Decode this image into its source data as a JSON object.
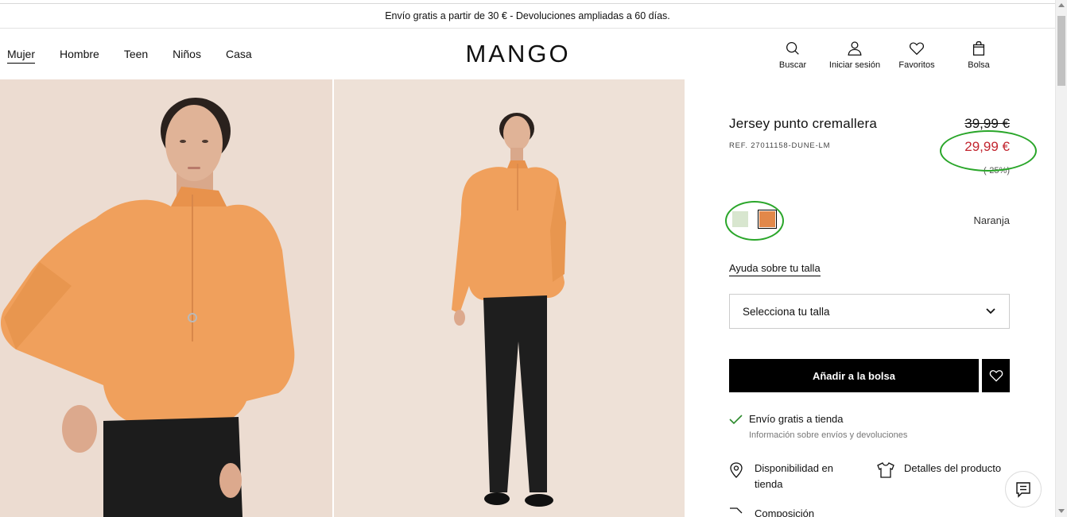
{
  "promo": {
    "text": "Envío gratis a partir de 30 € - Devoluciones ampliadas a 60 días."
  },
  "nav": {
    "items": [
      {
        "label": "Mujer",
        "active": true
      },
      {
        "label": "Hombre",
        "active": false
      },
      {
        "label": "Teen",
        "active": false
      },
      {
        "label": "Niños",
        "active": false
      },
      {
        "label": "Casa",
        "active": false
      }
    ]
  },
  "logo": "MANGO",
  "actions": {
    "search": "Buscar",
    "login": "Iniciar sesión",
    "favorites": "Favoritos",
    "bag": "Bolsa"
  },
  "product": {
    "title": "Jersey punto cremallera",
    "ref": "REF. 27011158-DUNE-LM",
    "price_old": "39,99 €",
    "price_new": "29,99 €",
    "discount": "(-25%)",
    "color_name": "Naranja",
    "swatches": [
      {
        "name": "green",
        "color": "#d8e6cf"
      },
      {
        "name": "orange",
        "color": "#e2884a",
        "selected": true
      }
    ],
    "size_help": "Ayuda sobre tu talla",
    "size_select": "Selecciona tu talla",
    "add_to_bag": "Añadir a la bolsa",
    "shipping": "Envío gratis a tienda",
    "shipping_info": "Información sobre envíos y devoluciones",
    "availability": "Disponibilidad en tienda",
    "details": "Detalles del producto",
    "more": "Composición"
  },
  "colors": {
    "sale_red": "#c2252f",
    "highlight_green": "#2aa62a",
    "sweater_orange": "#f0a05c",
    "background_beige": "#ecdcd1"
  }
}
